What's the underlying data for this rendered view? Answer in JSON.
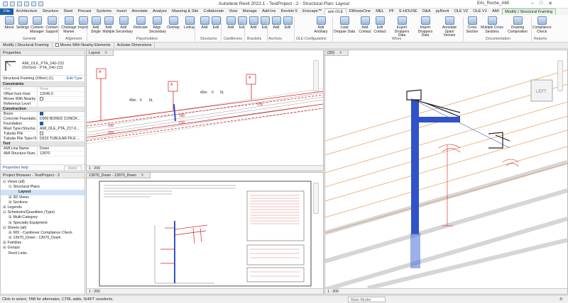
{
  "window": {
    "title": "Autodesk Revit 2022.1 - TestProject - 2 - Structural Plan: Layout",
    "user": "Eric_Roche_AMI"
  },
  "tabs": [
    {
      "label": "File"
    },
    {
      "label": "Architecture"
    },
    {
      "label": "Structure"
    },
    {
      "label": "Steel"
    },
    {
      "label": "Precast"
    },
    {
      "label": "Systems"
    },
    {
      "label": "Insert"
    },
    {
      "label": "Annotate"
    },
    {
      "label": "Analyze"
    },
    {
      "label": "Massing & Site"
    },
    {
      "label": "Collaborate"
    },
    {
      "label": "View"
    },
    {
      "label": "Manage"
    },
    {
      "label": "Add-Ins"
    },
    {
      "label": "Revizto 5"
    },
    {
      "label": "Enscape™"
    },
    {
      "label": "ami.OLE"
    },
    {
      "label": "DiRootsOne"
    },
    {
      "label": "MEL"
    },
    {
      "label": "PF"
    },
    {
      "label": "E-HOUSE"
    },
    {
      "label": "D&A"
    },
    {
      "label": "pyRevit"
    },
    {
      "label": "OLE V2"
    },
    {
      "label": "OLE V1"
    },
    {
      "label": "AMI"
    },
    {
      "label": "Modify | Structural Framing"
    }
  ],
  "ribbon": {
    "buttons": [
      {
        "label": "About"
      },
      {
        "label": "Settings"
      },
      {
        "label": "Content Manager"
      },
      {
        "label": "Contact Support"
      },
      {
        "label": "Chainage Marker"
      },
      {
        "label": "Import"
      },
      {
        "label": "Add Single"
      },
      {
        "label": "Add Multiple"
      },
      {
        "label": "Add Secondary"
      },
      {
        "label": "Relocate"
      },
      {
        "label": "Align Secondary"
      },
      {
        "label": "Overlap"
      },
      {
        "label": "Lookup"
      },
      {
        "label": "Add"
      },
      {
        "label": "Edit"
      },
      {
        "label": "Add"
      },
      {
        "label": "Edit"
      },
      {
        "label": "Add"
      },
      {
        "label": "Edit"
      },
      {
        "label": "Add"
      },
      {
        "label": "Edit"
      },
      {
        "label": "Add Ancillary"
      },
      {
        "label": "Load Dropper Data"
      },
      {
        "label": "Add Contact"
      },
      {
        "label": "Edit Contact"
      },
      {
        "label": "Export Droppers Data"
      },
      {
        "label": "Import Droppers Data"
      },
      {
        "label": "Annotate Span/ Version"
      },
      {
        "label": "Cross Section"
      },
      {
        "label": "Multiple Cross Sections"
      },
      {
        "label": "Drawing Composition"
      },
      {
        "label": "Compliance Check"
      }
    ],
    "groups": [
      {
        "label": "General"
      },
      {
        "label": "Alignment"
      },
      {
        "label": "Placeholders"
      },
      {
        "label": "Structures"
      },
      {
        "label": "Cantilevers"
      },
      {
        "label": "Brackets"
      },
      {
        "label": "Anchors"
      },
      {
        "label": "OLE Configuration"
      },
      {
        "label": "Wires"
      },
      {
        "label": "Documentation"
      },
      {
        "label": "Reports"
      }
    ]
  },
  "modbar": {
    "context": "Modify | Structural Framing",
    "moves_label": "Moves With Nearby Elements",
    "activate_label": "Activate Dimensions"
  },
  "properties": {
    "header": "Properties",
    "type_name": "AMI_OLE_PTA_040-232",
    "type_sub": "250SHS - PTA_040-232",
    "filter": "Structural Framing (Other) (1)",
    "edit_type": "Edit Type",
    "categories": {
      "constraints": "Constraints",
      "construction": "Construction",
      "text": "Text"
    },
    "rows_constraints": [
      {
        "k": "Host",
        "v": "None"
      },
      {
        "k": "Offset from Host",
        "v": "13246.0"
      },
      {
        "k": "Moves With Nearby ...",
        "v": ""
      },
      {
        "k": "Reference Level",
        "v": ""
      }
    ],
    "rows_construction": [
      {
        "k": "Boom",
        "v": ""
      },
      {
        "k": "Concrete Foundatio...",
        "v": "D900 BORED CONCR..."
      },
      {
        "k": "Foundation",
        "v": ""
      },
      {
        "k": "Mast Type<Structur...",
        "v": "AMI_OLE_PTA_217-0..."
      },
      {
        "k": "Tubular Pile",
        "v": ""
      },
      {
        "k": "Tubular Pile Type<S...",
        "v": "D610 TUBULAR PILE ..."
      }
    ],
    "rows_text": [
      {
        "k": "AMI Line Name",
        "v": "Down"
      },
      {
        "k": "AMI Structure Num...",
        "v": "13970"
      }
    ],
    "help": "Properties help",
    "apply": "Apply"
  },
  "browser": {
    "header": "Project Browser - TestProject - 2",
    "items": [
      {
        "label": "Views (all)",
        "ex": "⊟"
      },
      {
        "label": "Structural Plans",
        "ex": "⊟"
      },
      {
        "label": "Layout",
        "ex": ""
      },
      {
        "label": "3D Views",
        "ex": "⊞"
      },
      {
        "label": "Sections",
        "ex": "⊞"
      },
      {
        "label": "Legends",
        "ex": "⊞"
      },
      {
        "label": "Schedules/Quantities (Type)",
        "ex": "⊟"
      },
      {
        "label": "Multi-Category",
        "ex": "⊞"
      },
      {
        "label": "Specialty Equipment",
        "ex": "⊞"
      },
      {
        "label": "Sheets (all)",
        "ex": "⊟"
      },
      {
        "label": "000 - Cantilever Compliance Check",
        "ex": "⊞"
      },
      {
        "label": "13970_Down - 13970_Down",
        "ex": "⊞"
      },
      {
        "label": "Families",
        "ex": "⊞"
      },
      {
        "label": "Groups",
        "ex": "⊞"
      },
      {
        "label": "Revit Links",
        "ex": ""
      }
    ]
  },
  "views": {
    "layout": {
      "tab": "Layout",
      "tags": [
        "A",
        "A",
        "A"
      ],
      "nums": [
        "190",
        "200",
        "180",
        "230",
        "230"
      ],
      "lines": [
        "40m",
        "0",
        "5L"
      ],
      "scale": "1 : 200"
    },
    "sheet": {
      "tab": "13970_Down - 13970_Down",
      "scale": "1 : 200"
    },
    "v3d": {
      "tab": "{3D}",
      "cube": "LEFT",
      "scale": "1 : 200"
    }
  },
  "status": {
    "left": "Click to select, TAB for alternates, CTRL adds, SHIFT unselects.",
    "main_model": "Main Model",
    "zero": ":0"
  },
  "colors": {
    "accent": "#1b5fa8",
    "mast": "#2f53c8",
    "wire": "#e88a2e",
    "tag": "#d0201f"
  }
}
